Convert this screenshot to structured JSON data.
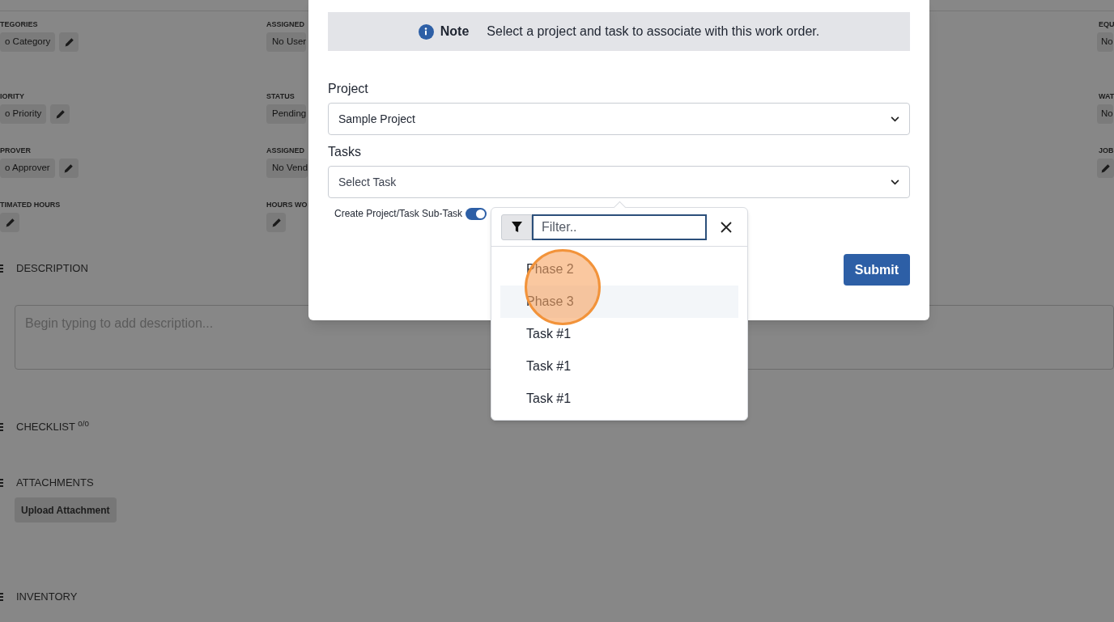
{
  "background": {
    "field_columns": [
      [
        {
          "label": "TEGORIES",
          "value": "o Category",
          "kind": "value_edit"
        },
        {
          "label": "IORITY",
          "value": "o Priority",
          "kind": "value_edit"
        },
        {
          "label": "PROVER",
          "value": "o Approver",
          "kind": "value_edit"
        },
        {
          "label": "TIMATED HOURS",
          "kind": "edit"
        }
      ],
      [
        {
          "label": "ASSIGNED",
          "value": "No User",
          "kind": "value"
        },
        {
          "label": "STATUS",
          "value": "Pending",
          "kind": "value"
        },
        {
          "label": "ASSIGNED",
          "value": "No Vend",
          "kind": "value"
        },
        {
          "label": "HOURS WO",
          "kind": "edit"
        }
      ],
      [
        {
          "label": "EQU",
          "value": "No",
          "kind": "value"
        },
        {
          "label": "WAT",
          "value": "No",
          "kind": "value"
        },
        {
          "label": "JOB",
          "kind": "edit"
        }
      ]
    ],
    "sections": [
      {
        "kind": "description",
        "title": "DESCRIPTION",
        "placeholder": "Begin typing to add description..."
      },
      {
        "kind": "checklist",
        "title": "CHECKLIST $^{0/0}$"
      },
      {
        "kind": "attachments",
        "title": "ATTACHMENTS",
        "button": "Upload Attachment"
      },
      {
        "kind": "inventory",
        "title": "INVENTORY"
      }
    ]
  },
  "modal": {
    "note": {
      "label": "Note",
      "text": "Select a project and task to associate with this work order."
    },
    "project": {
      "label": "Project",
      "value": "Sample Project"
    },
    "tasks": {
      "label": "Tasks",
      "placeholder": "Select Task"
    },
    "subtask_toggle": {
      "label": "Create Project/Task Sub-Task",
      "on": true
    },
    "submit": "Submit",
    "dropdown": {
      "filter_placeholder": "Filter..",
      "options": [
        {
          "label": "Phase 2",
          "selected": false
        },
        {
          "label": "Phase 3",
          "selected": true
        },
        {
          "label": "Task #1",
          "selected": false
        },
        {
          "label": "Task #1",
          "selected": false
        },
        {
          "label": "Task #1",
          "selected": false
        }
      ]
    }
  }
}
